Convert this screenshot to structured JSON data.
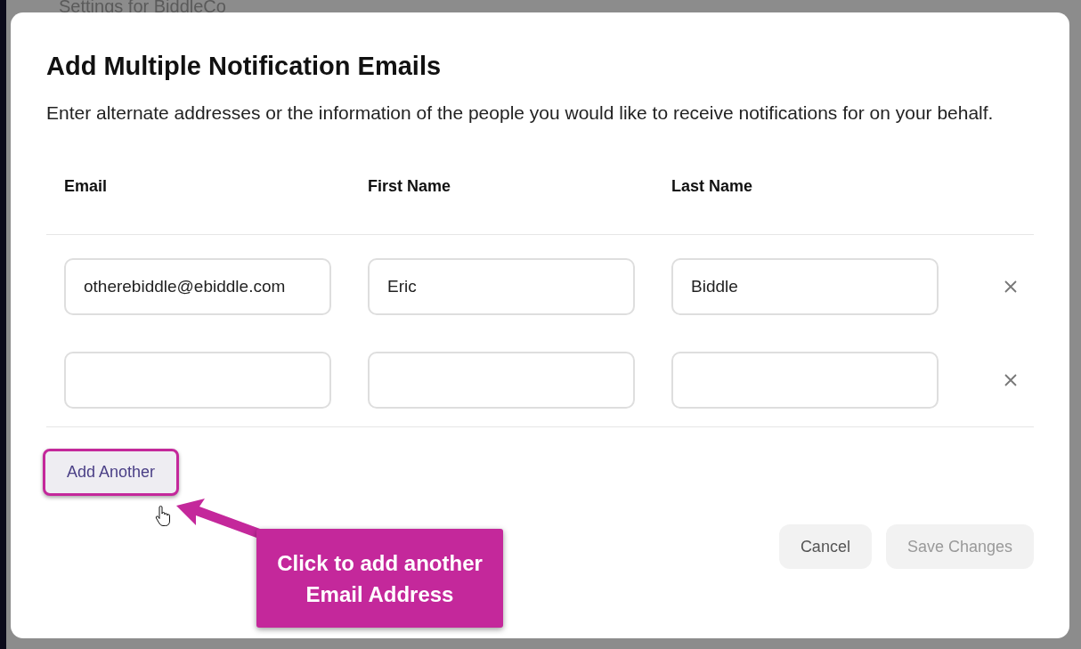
{
  "background": {
    "title": "Settings for BiddleCo"
  },
  "dialog": {
    "title": "Add Multiple Notification Emails",
    "description": "Enter alternate addresses or the information of the people you would like to receive notifications for on your behalf.",
    "columns": [
      "Email",
      "First Name",
      "Last Name"
    ],
    "rows": [
      {
        "email": "otherebiddle@ebiddle.com",
        "first_name": "Eric",
        "last_name": "Biddle"
      },
      {}
    ],
    "add_button": "Add Another",
    "buttons": [
      {
        "label": "Cancel",
        "disabled": false
      },
      {
        "label": "Save Changes",
        "disabled": true
      }
    ]
  },
  "annotation": {
    "text": "Click to add another Email Address"
  }
}
